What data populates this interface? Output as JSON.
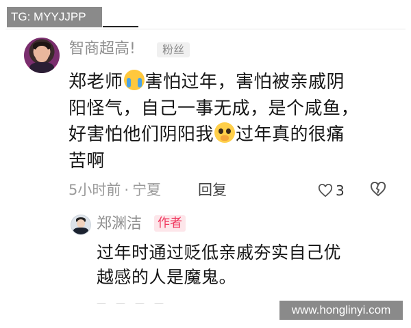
{
  "watermark_top": "TG: MYYJJPP",
  "comment": {
    "username": "智商超高!",
    "badge": "粉丝",
    "line1_a": "郑老师",
    "line1_b": "害怕过年，害怕被亲戚阴",
    "line2": "阳怪气，自己一事无成，是个咸鱼，",
    "line3_a": "好害怕他们阴阳我",
    "line3_b": "过年真的很痛",
    "line4": "苦啊",
    "emoji_1": "loudly-crying-face",
    "emoji_2": "pleading-face",
    "time": "5小时前",
    "separator": "·",
    "location": "宁夏",
    "reply_label": "回复",
    "like_count": "3"
  },
  "reply": {
    "author": "郑渊洁",
    "author_tag": "作者",
    "line1": "过年时通过贬低亲戚夯实自己优",
    "line2": "越感的人是魔鬼。"
  },
  "watermark_bottom": "www.honglinyi.com",
  "colors": {
    "author_tag_bg": "#fde6ea",
    "author_tag_text": "#f0395f",
    "muted_text": "#8f8f8f"
  }
}
